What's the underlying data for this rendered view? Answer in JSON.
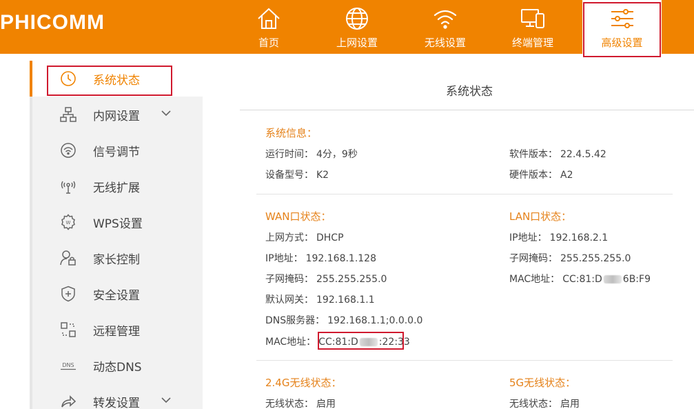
{
  "header": {
    "logo": "PHICOMM",
    "nav": [
      {
        "label": "首页",
        "icon": "home-icon"
      },
      {
        "label": "上网设置",
        "icon": "globe-icon"
      },
      {
        "label": "无线设置",
        "icon": "wifi-icon"
      },
      {
        "label": "终端管理",
        "icon": "devices-icon"
      },
      {
        "label": "高级设置",
        "icon": "sliders-icon"
      }
    ]
  },
  "sidebar": {
    "items": [
      {
        "label": "系统状态",
        "icon": "clock-icon"
      },
      {
        "label": "内网设置",
        "icon": "network-icon"
      },
      {
        "label": "信号调节",
        "icon": "signal-icon"
      },
      {
        "label": "无线扩展",
        "icon": "wireless-extend-icon"
      },
      {
        "label": "WPS设置",
        "icon": "wps-gear-icon"
      },
      {
        "label": "家长控制",
        "icon": "parental-lock-icon"
      },
      {
        "label": "安全设置",
        "icon": "shield-icon"
      },
      {
        "label": "远程管理",
        "icon": "remote-icon"
      },
      {
        "label": "动态DNS",
        "icon": "dns-icon"
      },
      {
        "label": "转发设置",
        "icon": "forward-icon"
      }
    ]
  },
  "main": {
    "title": "系统状态",
    "system": {
      "heading": "系统信息：",
      "uptime_label": "运行时间：",
      "uptime_value": "4分，9秒",
      "model_label": "设备型号：",
      "model_value": "K2",
      "sw_label": "软件版本：",
      "sw_value": "22.4.5.42",
      "hw_label": "硬件版本：",
      "hw_value": "A2"
    },
    "wan": {
      "heading": "WAN口状态：",
      "mode_label": "上网方式：",
      "mode_value": "DHCP",
      "ip_label": "IP地址：",
      "ip_value": "192.168.1.128",
      "mask_label": "子网掩码：",
      "mask_value": "255.255.255.0",
      "gw_label": "默认网关：",
      "gw_value": "192.168.1.1",
      "dns_label": "DNS服务器：",
      "dns_value": "192.168.1.1;0.0.0.0",
      "mac_label": "MAC地址：",
      "mac_prefix": "CC:81:D",
      "mac_suffix": ":22:33"
    },
    "lan": {
      "heading": "LAN口状态：",
      "ip_label": "IP地址：",
      "ip_value": "192.168.2.1",
      "mask_label": "子网掩码：",
      "mask_value": "255.255.255.0",
      "mac_label": "MAC地址：",
      "mac_prefix": "CC:81:D",
      "mac_suffix": "6B:F9"
    },
    "w24": {
      "heading": "2.4G无线状态：",
      "status_label": "无线状态：",
      "status_value": "启用"
    },
    "w5": {
      "heading": "5G无线状态：",
      "status_label": "无线状态：",
      "status_value": "启用"
    }
  },
  "colors": {
    "brand": "#f08300",
    "heading": "#e5821a",
    "highlight_box": "#d0192e"
  }
}
